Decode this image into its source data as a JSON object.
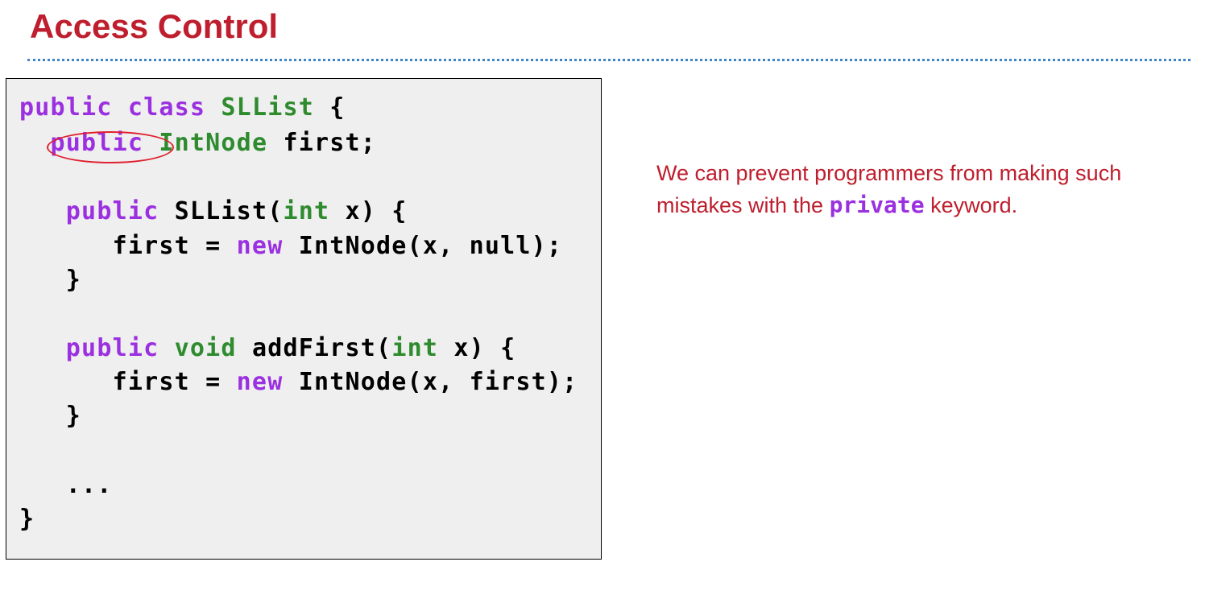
{
  "slide": {
    "title": "Access Control"
  },
  "code": {
    "lines": [
      {
        "tokens": [
          "public",
          " ",
          "class",
          " ",
          "SLList",
          " {"
        ]
      },
      {
        "tokens": [
          "  ",
          "public",
          " ",
          "IntNode",
          " first;"
        ]
      },
      {
        "tokens": [
          ""
        ]
      },
      {
        "tokens": [
          "   ",
          "public",
          " SLList(",
          "int",
          " x) {"
        ]
      },
      {
        "tokens": [
          "      first = ",
          "new",
          " IntNode(x, null);"
        ]
      },
      {
        "tokens": [
          "   }"
        ]
      },
      {
        "tokens": [
          ""
        ]
      },
      {
        "tokens": [
          "   ",
          "public",
          " ",
          "void",
          " addFirst(",
          "int",
          " x) {"
        ]
      },
      {
        "tokens": [
          "      first = ",
          "new",
          " IntNode(x, first);"
        ]
      },
      {
        "tokens": [
          "   }"
        ]
      },
      {
        "tokens": [
          ""
        ]
      },
      {
        "tokens": [
          "   ..."
        ]
      },
      {
        "tokens": [
          "}"
        ]
      }
    ]
  },
  "note": {
    "text_before": "We can prevent programmers from making such mistakes with the ",
    "keyword": "private",
    "text_after": " keyword."
  },
  "colors": {
    "title": "#be1e2d",
    "keyword_purple": "#9b30e0",
    "keyword_green": "#2e8b2e",
    "highlight_circle": "#e0202e",
    "divider": "#3d85c6",
    "code_background": "#efefef"
  }
}
